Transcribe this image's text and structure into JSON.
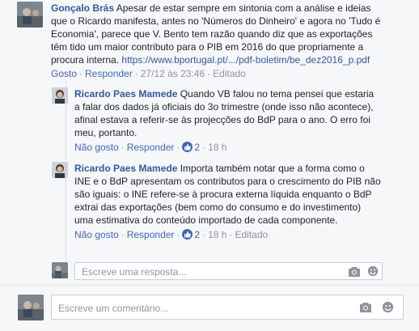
{
  "comments": [
    {
      "author": "Gonçalo Brás",
      "text": " Apesar de estar sempre em sintonia com a análise e ideias que o Ricardo manifesta, antes no 'Números do Dinheiro' e agora no 'Tudo é Economia', parece que V. Bento tem razão quando diz que as exportações têm tido um maior contributo para o PIB em 2016 do que propriamente a procura interna. ",
      "link": "https://www.bportugal.pt/.../pdf-boletim/be_dez2016_p.pdf",
      "action_like": "Gosto",
      "action_reply": "Responder",
      "time": "27/12 às 23:46",
      "edited": "Editado"
    }
  ],
  "replies": [
    {
      "author": "Ricardo Paes Mamede",
      "text": " Quando VB falou no tema pensei que estaria a falar dos dados já oficiais do 3o trimestre (onde isso não acontece), afinal estava a referir-se às projecções do BdP para o ano. O erro foi meu, portanto.",
      "action_like": "Não gosto",
      "action_reply": "Responder",
      "likes": "2",
      "time": "18 h"
    },
    {
      "author": "Ricardo Paes Mamede",
      "text": " Importa também notar que a forma como o INE e o BdP apresentam os contributos para o crescimento do PIB não são iguais: o INE refere-se à procura externa líquida enquanto o BdP extrai das exportações (bem como do consumo e do investimento) uma estimativa do conteúdo importado de cada componente.",
      "action_like": "Não gosto",
      "action_reply": "Responder",
      "likes": "2",
      "time": "18 h",
      "edited": "Editado"
    }
  ],
  "reply_input": {
    "placeholder": "Escreve uma resposta..."
  },
  "comment_input": {
    "placeholder": "Escreve um comentário..."
  },
  "icons": {
    "camera": "camera-icon",
    "sticker": "smiley-icon",
    "like": "thumbs-up-icon"
  },
  "colors": {
    "link": "#365899",
    "action": "#4267b2",
    "meta": "#90949c"
  }
}
